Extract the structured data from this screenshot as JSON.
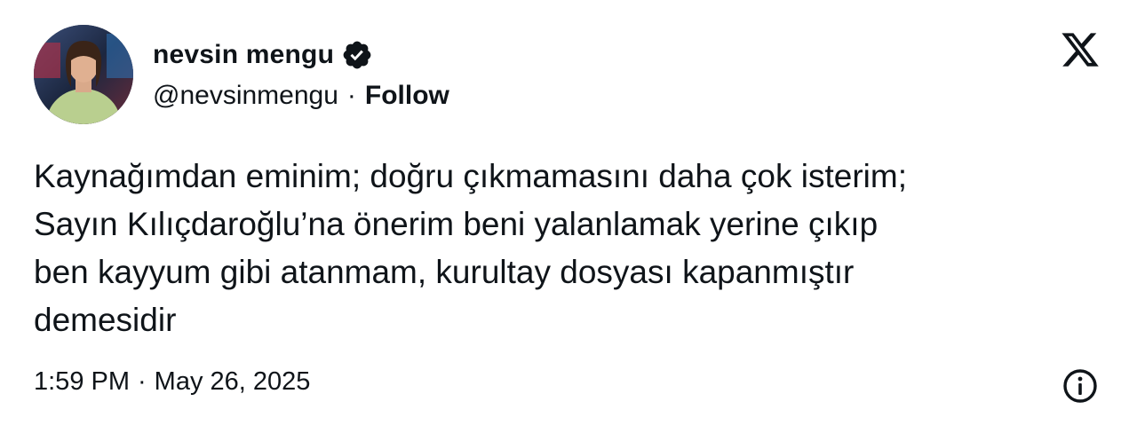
{
  "author": {
    "display_name": "nevsin mengu",
    "handle": "@nevsinmengu",
    "separator": "·",
    "follow_label": "Follow",
    "verified": true
  },
  "tweet": {
    "text": "Kaynağımdan eminim; doğru çıkmamasını daha çok isterim;\nSayın Kılıçdaroğlu’na önerim beni yalanlamak yerine çıkıp\nben kayyum gibi atanmam, kurultay dosyası kapanmıştır\ndemesidir",
    "time": "1:59 PM",
    "separator": "·",
    "date": "May 26, 2025"
  },
  "icons": {
    "brand": "x-logo-icon",
    "verified": "verified-badge-icon",
    "info": "info-icon"
  },
  "colors": {
    "text": "#0f1419",
    "background": "#ffffff"
  }
}
